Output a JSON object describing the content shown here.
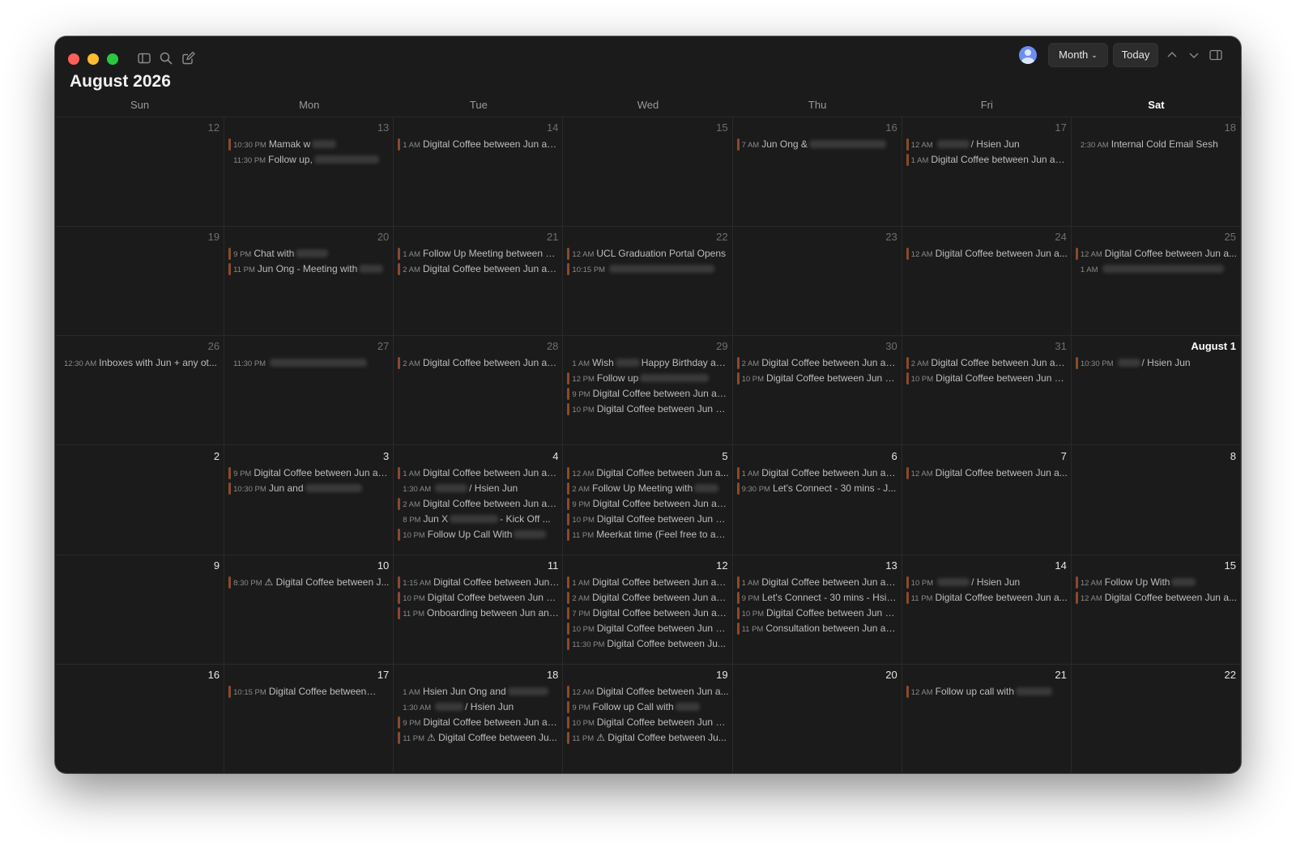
{
  "title": "August 2026",
  "toolbar": {
    "view_label": "Month",
    "today_label": "Today"
  },
  "weekdays": [
    "Sun",
    "Mon",
    "Tue",
    "Wed",
    "Thu",
    "Fri",
    "Sat"
  ],
  "colors": {
    "event_bar": "#8a4a2c",
    "background": "#1b1b1b"
  },
  "weeks": [
    [
      {
        "date": "12",
        "current": false,
        "events": []
      },
      {
        "date": "13",
        "current": false,
        "events": [
          {
            "time": "10:30 PM",
            "title": "Mamak w",
            "bar": true,
            "blur": 30
          },
          {
            "time": "11:30 PM",
            "title": "Follow up,",
            "bar": false,
            "blur": 80
          }
        ]
      },
      {
        "date": "14",
        "current": false,
        "events": [
          {
            "time": "1 AM",
            "title": "Digital Coffee between Jun an...",
            "bar": true
          }
        ]
      },
      {
        "date": "15",
        "current": false,
        "events": []
      },
      {
        "date": "16",
        "current": false,
        "events": [
          {
            "time": "7 AM",
            "title": "Jun Ong &",
            "bar": true,
            "blur": 95
          }
        ]
      },
      {
        "date": "17",
        "current": false,
        "events": [
          {
            "time": "12 AM",
            "title": "/ Hsien Jun",
            "bar": true,
            "blur_before": 40
          },
          {
            "time": "1 AM",
            "title": "Digital Coffee between Jun an...",
            "bar": true
          }
        ]
      },
      {
        "date": "18",
        "current": false,
        "events": [
          {
            "time": "2:30 AM",
            "title": "Internal Cold Email Sesh",
            "bar": false
          }
        ]
      }
    ],
    [
      {
        "date": "19",
        "current": false,
        "events": []
      },
      {
        "date": "20",
        "current": false,
        "events": [
          {
            "time": "9 PM",
            "title": "Chat with",
            "bar": true,
            "blur": 40
          },
          {
            "time": "11 PM",
            "title": "Jun Ong - Meeting with",
            "bar": true,
            "blur": 30
          }
        ]
      },
      {
        "date": "21",
        "current": false,
        "events": [
          {
            "time": "1 AM",
            "title": "Follow Up Meeting between Ju...",
            "bar": true
          },
          {
            "time": "2 AM",
            "title": "Digital Coffee between Jun an...",
            "bar": true
          }
        ]
      },
      {
        "date": "22",
        "current": false,
        "events": [
          {
            "time": "12 AM",
            "title": "UCL Graduation Portal Opens",
            "bar": true
          },
          {
            "time": "10:15 PM",
            "title": "",
            "bar": true,
            "blur": 130
          }
        ]
      },
      {
        "date": "23",
        "current": false,
        "events": []
      },
      {
        "date": "24",
        "current": false,
        "events": [
          {
            "time": "12 AM",
            "title": "Digital Coffee between Jun a...",
            "bar": true
          }
        ]
      },
      {
        "date": "25",
        "current": false,
        "events": [
          {
            "time": "12 AM",
            "title": "Digital Coffee between Jun a...",
            "bar": true
          },
          {
            "time": "1 AM",
            "title": "",
            "bar": false,
            "blur": 150
          }
        ]
      }
    ],
    [
      {
        "date": "26",
        "current": false,
        "events": [
          {
            "time": "12:30 AM",
            "title": "Inboxes with Jun + any ot...",
            "bar": false
          }
        ]
      },
      {
        "date": "27",
        "current": false,
        "events": [
          {
            "time": "11:30 PM",
            "title": "",
            "bar": false,
            "blur": 120
          }
        ]
      },
      {
        "date": "28",
        "current": false,
        "events": [
          {
            "time": "2 AM",
            "title": "Digital Coffee between Jun an...",
            "bar": true
          }
        ]
      },
      {
        "date": "29",
        "current": false,
        "events": [
          {
            "time": "1 AM",
            "title": "Wish",
            "suffix": "Happy Birthday an...",
            "bar": false,
            "blur": 30
          },
          {
            "time": "12 PM",
            "title": "Follow up",
            "bar": true,
            "blur": 85
          },
          {
            "time": "9 PM",
            "title": "Digital Coffee between Jun an...",
            "bar": true
          },
          {
            "time": "10 PM",
            "title": "Digital Coffee between Jun a...",
            "bar": true
          }
        ]
      },
      {
        "date": "30",
        "current": false,
        "events": [
          {
            "time": "2 AM",
            "title": "Digital Coffee between Jun an...",
            "bar": true
          },
          {
            "time": "10 PM",
            "title": "Digital Coffee between Jun a...",
            "bar": true
          }
        ]
      },
      {
        "date": "31",
        "current": false,
        "events": [
          {
            "time": "2 AM",
            "title": "Digital Coffee between Jun an...",
            "bar": true
          },
          {
            "time": "10 PM",
            "title": "Digital Coffee between Jun a...",
            "bar": true
          }
        ]
      },
      {
        "date": "August 1",
        "current": true,
        "bold": true,
        "events": [
          {
            "time": "10:30 PM",
            "title": "/ Hsien Jun",
            "bar": true,
            "blur_before": 28
          }
        ]
      }
    ],
    [
      {
        "date": "2",
        "current": true,
        "events": []
      },
      {
        "date": "3",
        "current": true,
        "events": [
          {
            "time": "9 PM",
            "title": "Digital Coffee between Jun an...",
            "bar": true
          },
          {
            "time": "10:30 PM",
            "title": "Jun and",
            "bar": true,
            "blur": 70
          }
        ]
      },
      {
        "date": "4",
        "current": true,
        "events": [
          {
            "time": "1 AM",
            "title": "Digital Coffee between Jun an...",
            "bar": true
          },
          {
            "time": "1:30 AM",
            "title": "/ Hsien Jun",
            "bar": false,
            "blur_before": 40
          },
          {
            "time": "2 AM",
            "title": "Digital Coffee between Jun an...",
            "bar": true
          },
          {
            "time": "8 PM",
            "title": "Jun X",
            "suffix": "- Kick Off ...",
            "bar": false,
            "blur": 60
          },
          {
            "time": "10 PM",
            "title": "Follow Up Call With",
            "bar": true,
            "blur": 40
          }
        ]
      },
      {
        "date": "5",
        "current": true,
        "events": [
          {
            "time": "12 AM",
            "title": "Digital Coffee between Jun a...",
            "bar": true
          },
          {
            "time": "2 AM",
            "title": "Follow Up Meeting with",
            "bar": true,
            "blur": 30
          },
          {
            "time": "9 PM",
            "title": "Digital Coffee between Jun an...",
            "bar": true
          },
          {
            "time": "10 PM",
            "title": "Digital Coffee between Jun a...",
            "bar": true
          },
          {
            "time": "11 PM",
            "title": "Meerkat time (Feel free to adj...",
            "bar": true
          }
        ]
      },
      {
        "date": "6",
        "current": true,
        "events": [
          {
            "time": "1 AM",
            "title": "Digital Coffee between Jun an...",
            "bar": true
          },
          {
            "time": "9:30 PM",
            "title": "Let's Connect - 30 mins - J...",
            "bar": true
          }
        ]
      },
      {
        "date": "7",
        "current": true,
        "events": [
          {
            "time": "12 AM",
            "title": "Digital Coffee between Jun a...",
            "bar": true
          }
        ]
      },
      {
        "date": "8",
        "current": true,
        "events": []
      }
    ],
    [
      {
        "date": "9",
        "current": true,
        "events": []
      },
      {
        "date": "10",
        "current": true,
        "events": [
          {
            "time": "8:30 PM",
            "title": "⚠ Digital Coffee between J...",
            "bar": true
          }
        ]
      },
      {
        "date": "11",
        "current": true,
        "events": [
          {
            "time": "1:15 AM",
            "title": "Digital Coffee between Jun ...",
            "bar": true
          },
          {
            "time": "10 PM",
            "title": "Digital Coffee between Jun a...",
            "bar": true
          },
          {
            "time": "11 PM",
            "title": "Onboarding between Jun and...",
            "bar": true
          }
        ]
      },
      {
        "date": "12",
        "current": true,
        "events": [
          {
            "time": "1 AM",
            "title": "Digital Coffee between Jun an...",
            "bar": true
          },
          {
            "time": "2 AM",
            "title": "Digital Coffee between Jun an...",
            "bar": true
          },
          {
            "time": "7 PM",
            "title": "Digital Coffee between Jun an...",
            "bar": true
          },
          {
            "time": "10 PM",
            "title": "Digital Coffee between Jun a...",
            "bar": true
          },
          {
            "time": "11:30 PM",
            "title": "Digital Coffee between Ju...",
            "bar": true
          }
        ]
      },
      {
        "date": "13",
        "current": true,
        "events": [
          {
            "time": "1 AM",
            "title": "Digital Coffee between Jun an...",
            "bar": true
          },
          {
            "time": "9 PM",
            "title": "Let's Connect - 30 mins - Hsie...",
            "bar": true
          },
          {
            "time": "10 PM",
            "title": "Digital Coffee between Jun a...",
            "bar": true
          },
          {
            "time": "11 PM",
            "title": "Consultation between Jun an...",
            "bar": true
          }
        ]
      },
      {
        "date": "14",
        "current": true,
        "events": [
          {
            "time": "10 PM",
            "title": "/ Hsien Jun",
            "bar": true,
            "blur_before": 40
          },
          {
            "time": "11 PM",
            "title": "Digital Coffee between Jun a...",
            "bar": true
          }
        ]
      },
      {
        "date": "15",
        "current": true,
        "events": [
          {
            "time": "12 AM",
            "title": "Follow Up With",
            "bar": true,
            "blur": 30
          },
          {
            "time": "12 AM",
            "title": "Digital Coffee between Jun a...",
            "bar": true
          }
        ]
      }
    ],
    [
      {
        "date": "16",
        "current": true,
        "events": []
      },
      {
        "date": "17",
        "current": true,
        "events": [
          {
            "time": "10:15 PM",
            "title": "Digital Coffee between",
            "bar": true,
            "blur": 25
          }
        ]
      },
      {
        "date": "18",
        "current": true,
        "events": [
          {
            "time": "1 AM",
            "title": "Hsien Jun Ong and",
            "bar": false,
            "blur": 50
          },
          {
            "time": "1:30 AM",
            "title": "/ Hsien Jun",
            "bar": false,
            "blur_before": 35
          },
          {
            "time": "9 PM",
            "title": "Digital Coffee between Jun an...",
            "bar": true
          },
          {
            "time": "11 PM",
            "title": "⚠ Digital Coffee between Ju...",
            "bar": true
          }
        ]
      },
      {
        "date": "19",
        "current": true,
        "events": [
          {
            "time": "12 AM",
            "title": "Digital Coffee between Jun a...",
            "bar": true
          },
          {
            "time": "9 PM",
            "title": "Follow up Call with",
            "bar": true,
            "blur": 30
          },
          {
            "time": "10 PM",
            "title": "Digital Coffee between Jun a...",
            "bar": true
          },
          {
            "time": "11 PM",
            "title": "⚠ Digital Coffee between Ju...",
            "bar": true
          }
        ]
      },
      {
        "date": "20",
        "current": true,
        "events": []
      },
      {
        "date": "21",
        "current": true,
        "events": [
          {
            "time": "12 AM",
            "title": "Follow up call with",
            "bar": true,
            "blur": 45
          }
        ]
      },
      {
        "date": "22",
        "current": true,
        "events": []
      }
    ]
  ]
}
